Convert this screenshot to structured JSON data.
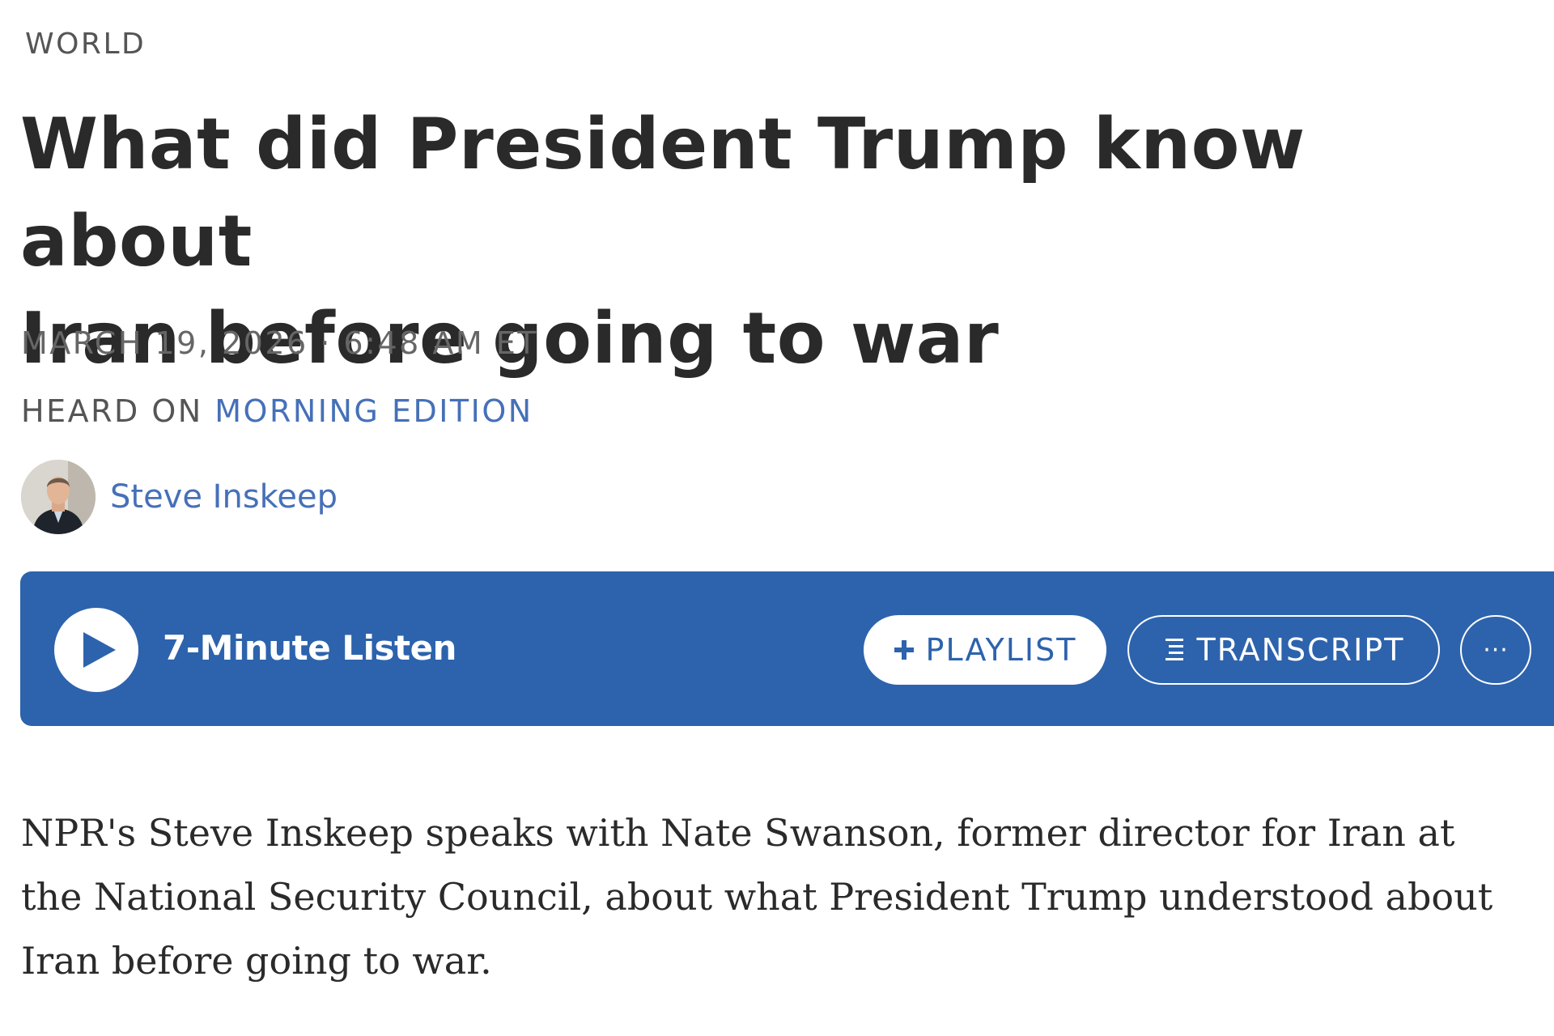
{
  "section": {
    "label": "WORLD"
  },
  "headline": {
    "line1": "What did President Trump know about",
    "line2": "Iran before going to war"
  },
  "dateline": "MARCH 19, 2026 · 6:48 AM ET",
  "heard_on": {
    "prefix": "HEARD ON",
    "show": "MORNING EDITION"
  },
  "byline": {
    "author": "Steve Inskeep",
    "avatar_icon": "author-avatar"
  },
  "player": {
    "listen_label": "7-Minute Listen",
    "playlist_label": "PLAYLIST",
    "transcript_label": "TRANSCRIPT",
    "more_label": "···",
    "background_color": "#2d63ad"
  },
  "teaser": {
    "line1": "NPR's Steve Inskeep speaks with Nate Swanson, former director for Iran at",
    "line2": "the National Security Council, about what President Trump understood about",
    "line3": "Iran before going to war."
  },
  "colors": {
    "link": "#4670b8",
    "text": "#2a2a2a",
    "meta": "#666666"
  }
}
